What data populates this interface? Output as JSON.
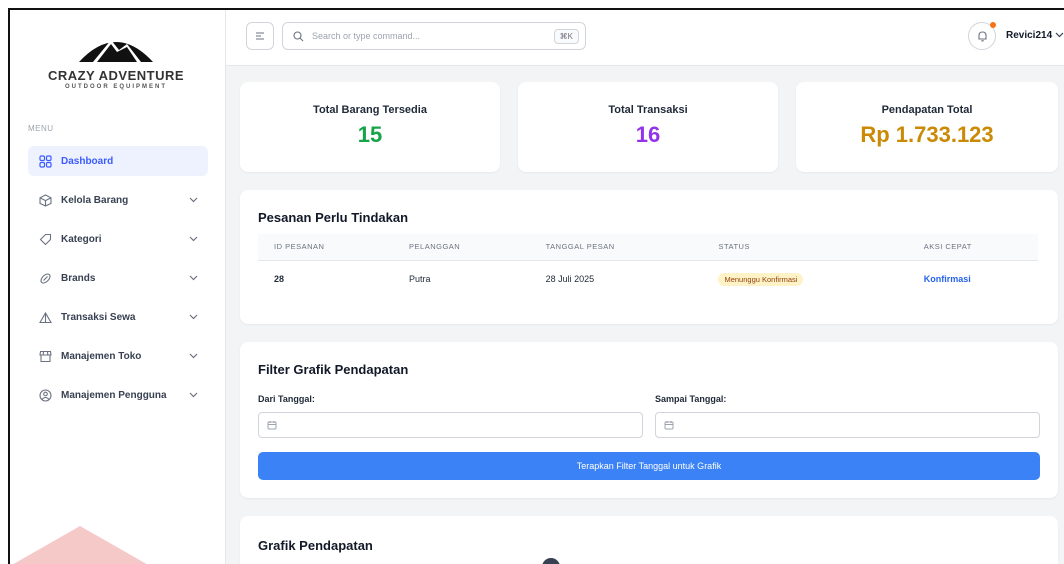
{
  "brand": {
    "title": "CRAZY ADVENTURE",
    "subtitle": "OUTDOOR EQUIPMENT"
  },
  "sidebar": {
    "menu_label": "MENU",
    "items": [
      {
        "label": "Dashboard",
        "icon": "grid-icon",
        "active": true
      },
      {
        "label": "Kelola Barang",
        "icon": "box-icon"
      },
      {
        "label": "Kategori",
        "icon": "tag-icon"
      },
      {
        "label": "Brands",
        "icon": "brand-icon"
      },
      {
        "label": "Transaksi Sewa",
        "icon": "tent-icon"
      },
      {
        "label": "Manajemen Toko",
        "icon": "store-icon"
      },
      {
        "label": "Manajemen Pengguna",
        "icon": "user-icon"
      }
    ]
  },
  "header": {
    "search_placeholder": "Search or type command...",
    "shortcut": "⌘K",
    "user": "Revici214"
  },
  "stats": [
    {
      "title": "Total Barang Tersedia",
      "value": "15",
      "color": "#16a34a"
    },
    {
      "title": "Total Transaksi",
      "value": "16",
      "color": "#9333ea"
    },
    {
      "title": "Pendapatan Total",
      "value": "Rp 1.733.123",
      "color": "#ca8a04"
    }
  ],
  "orders": {
    "title": "Pesanan Perlu Tindakan",
    "columns": [
      "ID PESANAN",
      "PELANGGAN",
      "TANGGAL PESAN",
      "STATUS",
      "AKSI CEPAT"
    ],
    "rows": [
      {
        "id": "28",
        "customer": "Putra",
        "date": "28 Juli 2025",
        "status": "Menunggu Konfirmasi",
        "action": "Konfirmasi"
      }
    ]
  },
  "filter": {
    "title": "Filter Grafik Pendapatan",
    "from_label": "Dari Tanggal:",
    "to_label": "Sampai Tanggal:",
    "button": "Terapkan Filter Tanggal untuk Grafik"
  },
  "chart_section": {
    "title": "Grafik Pendapatan"
  }
}
